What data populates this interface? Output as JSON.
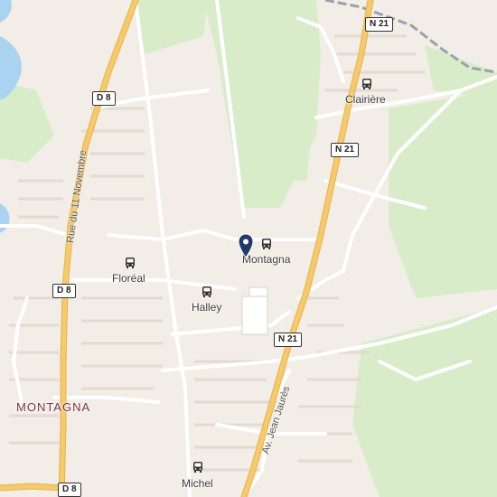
{
  "map": {
    "town_label": "MONTAGNA",
    "streets": {
      "rue_11_novembre": "Rue du 11 Novembre",
      "av_jean_jaures": "Av. Jean Jaurès"
    },
    "road_shields": [
      {
        "id": "n21-top",
        "text": "N 21"
      },
      {
        "id": "n21-mid",
        "text": "N 21"
      },
      {
        "id": "n21-low",
        "text": "N 21"
      },
      {
        "id": "d8-top",
        "text": "D 8"
      },
      {
        "id": "d8-mid",
        "text": "D 8"
      },
      {
        "id": "d8-bot",
        "text": "D 8"
      }
    ],
    "bus_stops": [
      {
        "id": "clairiere",
        "label": "Clairière"
      },
      {
        "id": "montagna",
        "label": "Montagna"
      },
      {
        "id": "floreal",
        "label": "Floréal"
      },
      {
        "id": "halley",
        "label": "Halley"
      },
      {
        "id": "michel",
        "label": "Michel"
      }
    ],
    "marker_icon": "map-pin-icon",
    "bus_icon": "bus-icon",
    "colors": {
      "land": "#f2ede6",
      "park": "#d8ecc9",
      "water": "#a9d3f0",
      "major_road": "#f6c96a",
      "road": "#ffffff",
      "marker": "#1e3a6b"
    }
  }
}
